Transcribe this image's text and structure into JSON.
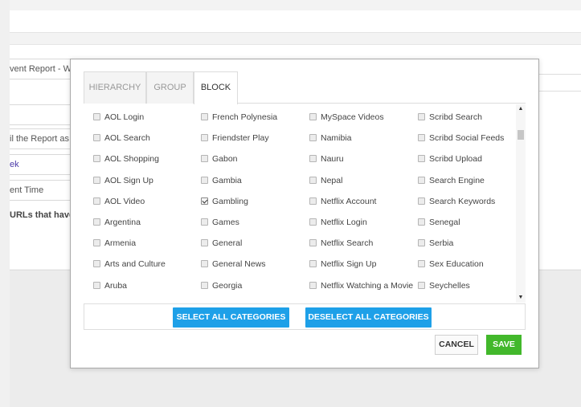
{
  "background": {
    "report_name_value": "vent Report - We",
    "email_label": "il the Report as A",
    "link_text": "ek",
    "time_label": "ent Time",
    "urls_text": "URLs that have"
  },
  "dialog": {
    "tabs": [
      {
        "label": "HIERARCHY",
        "active": false
      },
      {
        "label": "GROUP",
        "active": false
      },
      {
        "label": "BLOCK",
        "active": true
      }
    ],
    "columns": [
      [
        {
          "label": "AOL Login",
          "checked": false
        },
        {
          "label": "AOL Search",
          "checked": false
        },
        {
          "label": "AOL Shopping",
          "checked": false
        },
        {
          "label": "AOL Sign Up",
          "checked": false
        },
        {
          "label": "AOL Video",
          "checked": false
        },
        {
          "label": "Argentina",
          "checked": false
        },
        {
          "label": "Armenia",
          "checked": false
        },
        {
          "label": "Arts and Culture",
          "checked": false
        },
        {
          "label": "Aruba",
          "checked": false
        }
      ],
      [
        {
          "label": "French Polynesia",
          "checked": false
        },
        {
          "label": "Friendster Play",
          "checked": false
        },
        {
          "label": "Gabon",
          "checked": false
        },
        {
          "label": "Gambia",
          "checked": false
        },
        {
          "label": "Gambling",
          "checked": true
        },
        {
          "label": "Games",
          "checked": false
        },
        {
          "label": "General",
          "checked": false
        },
        {
          "label": "General News",
          "checked": false
        },
        {
          "label": "Georgia",
          "checked": false
        }
      ],
      [
        {
          "label": "MySpace Videos",
          "checked": false
        },
        {
          "label": "Namibia",
          "checked": false
        },
        {
          "label": "Nauru",
          "checked": false
        },
        {
          "label": "Nepal",
          "checked": false
        },
        {
          "label": "Netflix Account",
          "checked": false
        },
        {
          "label": "Netflix Login",
          "checked": false
        },
        {
          "label": "Netflix Search",
          "checked": false
        },
        {
          "label": "Netflix Sign Up",
          "checked": false
        },
        {
          "label": "Netflix Watching a Movie",
          "checked": false
        }
      ],
      [
        {
          "label": "Scribd Search",
          "checked": false
        },
        {
          "label": "Scribd Social Feeds",
          "checked": false
        },
        {
          "label": "Scribd Upload",
          "checked": false
        },
        {
          "label": "Search Engine",
          "checked": false
        },
        {
          "label": "Search Keywords",
          "checked": false
        },
        {
          "label": "Senegal",
          "checked": false
        },
        {
          "label": "Serbia",
          "checked": false
        },
        {
          "label": "Sex Education",
          "checked": false
        },
        {
          "label": "Seychelles",
          "checked": false
        }
      ]
    ],
    "select_all_label": "SELECT ALL CATEGORIES",
    "deselect_all_label": "DESELECT ALL CATEGORIES",
    "cancel_label": "CANCEL",
    "save_label": "SAVE",
    "scroll_up_icon": "▲",
    "scroll_down_icon": "▼"
  },
  "colors": {
    "primary_blue": "#1ea0e8",
    "save_green": "#42b82b"
  }
}
